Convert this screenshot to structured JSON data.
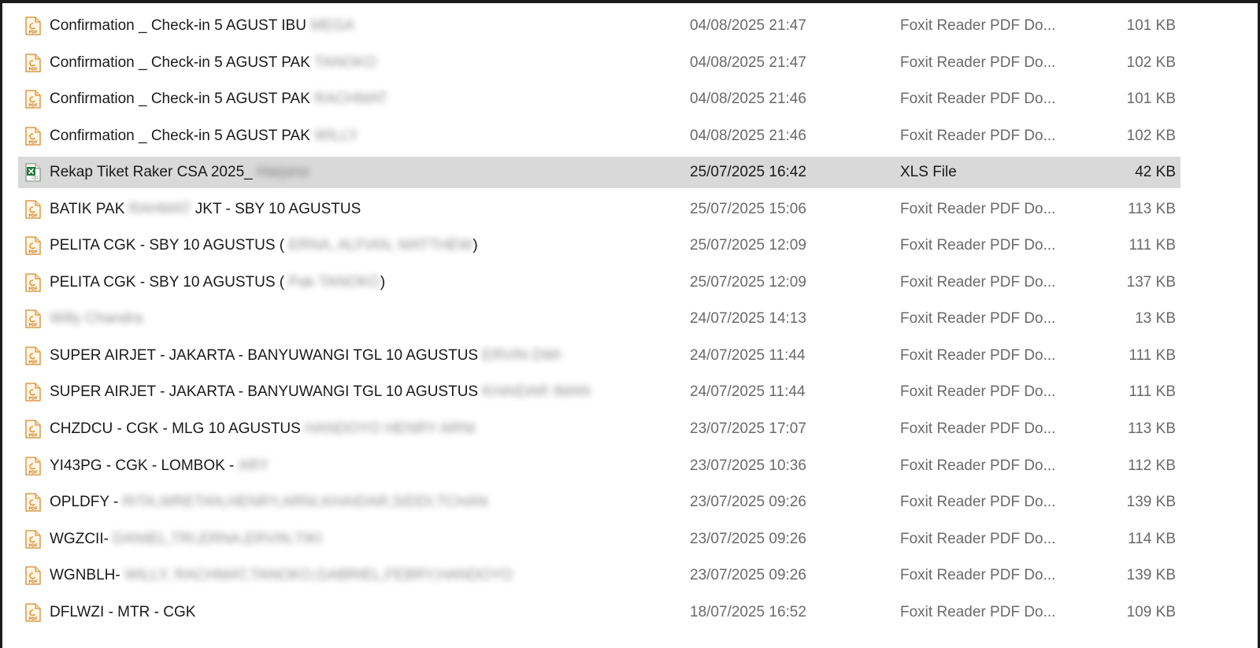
{
  "colors": {
    "selected_row_bg": "#d9d9d9",
    "pdf_icon_accent": "#e0952b",
    "xls_icon_accent": "#1e7a3a",
    "frame_border": "#1c1c1c"
  },
  "files": [
    {
      "name": "Confirmation _ Check-in 5 AGUST IBU",
      "blurred_suffix": "MEGA",
      "date": "04/08/2025 21:47",
      "type": "Foxit Reader PDF Do...",
      "size": "101 KB",
      "icon": "pdf-file-icon",
      "selected": false
    },
    {
      "name": "Confirmation _ Check-in 5 AGUST PAK",
      "blurred_suffix": "TANOKO",
      "date": "04/08/2025 21:47",
      "type": "Foxit Reader PDF Do...",
      "size": "102 KB",
      "icon": "pdf-file-icon",
      "selected": false
    },
    {
      "name": "Confirmation _ Check-in 5 AGUST PAK",
      "blurred_suffix": "RACHMAT",
      "date": "04/08/2025 21:46",
      "type": "Foxit Reader PDF Do...",
      "size": "101 KB",
      "icon": "pdf-file-icon",
      "selected": false
    },
    {
      "name": "Confirmation _ Check-in 5 AGUST PAK",
      "blurred_suffix": "WILLY",
      "date": "04/08/2025 21:46",
      "type": "Foxit Reader PDF Do...",
      "size": "102 KB",
      "icon": "pdf-file-icon",
      "selected": false
    },
    {
      "name": "Rekap Tiket Raker CSA 2025_",
      "blurred_suffix": "Harjono",
      "date": "25/07/2025 16:42",
      "type": "XLS File",
      "size": "42 KB",
      "icon": "xls-file-icon",
      "selected": true
    },
    {
      "name": "BATIK PAK",
      "blurred_suffix": "RAHMAT",
      "name_after": "JKT - SBY 10 AGUSTUS",
      "date": "25/07/2025 15:06",
      "type": "Foxit Reader PDF Do...",
      "size": "113 KB",
      "icon": "pdf-file-icon",
      "selected": false
    },
    {
      "name": "PELITA CGK - SBY 10 AGUSTUS (",
      "blurred_suffix": "ERNA, ALFIAN, MATTHEW",
      "name_after": ")",
      "date": "25/07/2025 12:09",
      "type": "Foxit Reader PDF Do...",
      "size": "111 KB",
      "icon": "pdf-file-icon",
      "selected": false
    },
    {
      "name": "PELITA CGK - SBY 10 AGUSTUS (",
      "blurred_suffix": "Pak TANOKO",
      "name_after": ")",
      "date": "25/07/2025 12:09",
      "type": "Foxit Reader PDF Do...",
      "size": "137 KB",
      "icon": "pdf-file-icon",
      "selected": false
    },
    {
      "name": "",
      "blurred_suffix": "Willy Chandra",
      "date": "24/07/2025 14:13",
      "type": "Foxit Reader PDF Do...",
      "size": "13 KB",
      "icon": "pdf-file-icon",
      "selected": false
    },
    {
      "name": "SUPER AIRJET - JAKARTA - BANYUWANGI TGL 10 AGUSTUS",
      "blurred_suffix": "ERVIN DWI",
      "date": "24/07/2025 11:44",
      "type": "Foxit Reader PDF Do...",
      "size": "111 KB",
      "icon": "pdf-file-icon",
      "selected": false
    },
    {
      "name": "SUPER AIRJET - JAKARTA - BANYUWANGI TGL 10 AGUSTUS",
      "blurred_suffix": "KHAIDAR IMAN",
      "date": "24/07/2025 11:44",
      "type": "Foxit Reader PDF Do...",
      "size": "111 KB",
      "icon": "pdf-file-icon",
      "selected": false
    },
    {
      "name": "CHZDCU - CGK - MLG 10 AGUSTUS",
      "blurred_suffix": "HANDOYO HENRY ARNI",
      "date": "23/07/2025 17:07",
      "type": "Foxit Reader PDF Do...",
      "size": "113 KB",
      "icon": "pdf-file-icon",
      "selected": false
    },
    {
      "name": "YI43PG - CGK - LOMBOK -",
      "blurred_suffix": "ARY",
      "date": "23/07/2025 10:36",
      "type": "Foxit Reader PDF Do...",
      "size": "112 KB",
      "icon": "pdf-file-icon",
      "selected": false
    },
    {
      "name": "OPLDFY -",
      "blurred_suffix": "RITA,WRETAN,HENRY,ARNI,KHAIDAR,SIDDI,TCHAN",
      "date": "23/07/2025 09:26",
      "type": "Foxit Reader PDF Do...",
      "size": "139 KB",
      "icon": "pdf-file-icon",
      "selected": false
    },
    {
      "name": "WGZCII-",
      "blurred_suffix": "DANIEL,TRI,ERNA,ERVIN,TIKI",
      "date": "23/07/2025 09:26",
      "type": "Foxit Reader PDF Do...",
      "size": "114 KB",
      "icon": "pdf-file-icon",
      "selected": false
    },
    {
      "name": "WGNBLH-",
      "blurred_suffix": "WILLY, RACHMAT,TANOKO,GABRIEL,FEBRY,HANDOYO",
      "date": "23/07/2025 09:26",
      "type": "Foxit Reader PDF Do...",
      "size": "139 KB",
      "icon": "pdf-file-icon",
      "selected": false
    },
    {
      "name": "DFLWZI - MTR - CGK",
      "blurred_suffix": "",
      "date": "18/07/2025 16:52",
      "type": "Foxit Reader PDF Do...",
      "size": "109 KB",
      "icon": "pdf-file-icon",
      "selected": false
    }
  ]
}
